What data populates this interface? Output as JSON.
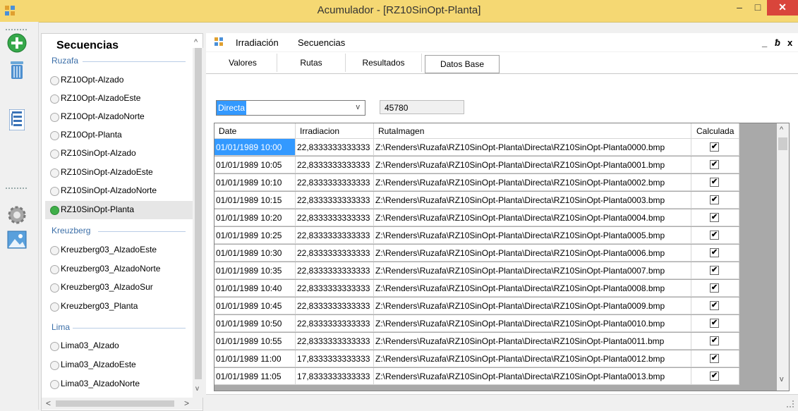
{
  "window": {
    "title": "Acumulador - [RZ10SinOpt-Planta]",
    "min_glyph": "–",
    "max_glyph": "□",
    "close_glyph": "✕"
  },
  "toolbar": {
    "icons": [
      "add-icon",
      "trash-icon",
      "tree-icon",
      "gear-icon",
      "image-icon"
    ]
  },
  "sequences": {
    "title": "Secuencias",
    "groups": [
      {
        "label": "Ruzafa"
      },
      {
        "label": "Kreuzberg"
      },
      {
        "label": "Lima"
      }
    ],
    "items": [
      "RZ10Opt-Alzado",
      "RZ10Opt-AlzadoEste",
      "RZ10Opt-AlzadoNorte",
      "RZ10Opt-Planta",
      "RZ10SinOpt-Alzado",
      "RZ10SinOpt-AlzadoEste",
      "RZ10SinOpt-AlzadoNorte",
      "RZ10SinOpt-Planta",
      "Kreuzberg03_AlzadoEste",
      "Kreuzberg03_AlzadoNorte",
      "Kreuzberg03_AlzadoSur",
      "Kreuzberg03_Planta",
      "Lima03_Alzado",
      "Lima03_AlzadoEste",
      "Lima03_AlzadoNorte"
    ],
    "selected": "RZ10SinOpt-Planta"
  },
  "menu": {
    "items": [
      "Irradiación",
      "Secuencias"
    ],
    "mdi_min": "_",
    "mdi_restore": "ƀ",
    "mdi_close": "x"
  },
  "tabs": [
    "Valores",
    "Rutas",
    "Resultados",
    "Datos Base"
  ],
  "active_tab": "Datos Base",
  "filter": {
    "dropdown_value": "Directa",
    "count_value": "45780"
  },
  "grid": {
    "columns": [
      "Date",
      "Irradiacion",
      "RutaImagen",
      "Calculada"
    ],
    "check_glyph": "✔",
    "rows": [
      {
        "date": "01/01/1989 10:00",
        "irr": "22,8333333333333",
        "ruta": "Z:\\Renders\\Ruzafa\\RZ10SinOpt-Planta\\Directa\\RZ10SinOpt-Planta0000.bmp"
      },
      {
        "date": "01/01/1989 10:05",
        "irr": "22,8333333333333",
        "ruta": "Z:\\Renders\\Ruzafa\\RZ10SinOpt-Planta\\Directa\\RZ10SinOpt-Planta0001.bmp"
      },
      {
        "date": "01/01/1989 10:10",
        "irr": "22,8333333333333",
        "ruta": "Z:\\Renders\\Ruzafa\\RZ10SinOpt-Planta\\Directa\\RZ10SinOpt-Planta0002.bmp"
      },
      {
        "date": "01/01/1989 10:15",
        "irr": "22,8333333333333",
        "ruta": "Z:\\Renders\\Ruzafa\\RZ10SinOpt-Planta\\Directa\\RZ10SinOpt-Planta0003.bmp"
      },
      {
        "date": "01/01/1989 10:20",
        "irr": "22,8333333333333",
        "ruta": "Z:\\Renders\\Ruzafa\\RZ10SinOpt-Planta\\Directa\\RZ10SinOpt-Planta0004.bmp"
      },
      {
        "date": "01/01/1989 10:25",
        "irr": "22,8333333333333",
        "ruta": "Z:\\Renders\\Ruzafa\\RZ10SinOpt-Planta\\Directa\\RZ10SinOpt-Planta0005.bmp"
      },
      {
        "date": "01/01/1989 10:30",
        "irr": "22,8333333333333",
        "ruta": "Z:\\Renders\\Ruzafa\\RZ10SinOpt-Planta\\Directa\\RZ10SinOpt-Planta0006.bmp"
      },
      {
        "date": "01/01/1989 10:35",
        "irr": "22,8333333333333",
        "ruta": "Z:\\Renders\\Ruzafa\\RZ10SinOpt-Planta\\Directa\\RZ10SinOpt-Planta0007.bmp"
      },
      {
        "date": "01/01/1989 10:40",
        "irr": "22,8333333333333",
        "ruta": "Z:\\Renders\\Ruzafa\\RZ10SinOpt-Planta\\Directa\\RZ10SinOpt-Planta0008.bmp"
      },
      {
        "date": "01/01/1989 10:45",
        "irr": "22,8333333333333",
        "ruta": "Z:\\Renders\\Ruzafa\\RZ10SinOpt-Planta\\Directa\\RZ10SinOpt-Planta0009.bmp"
      },
      {
        "date": "01/01/1989 10:50",
        "irr": "22,8333333333333",
        "ruta": "Z:\\Renders\\Ruzafa\\RZ10SinOpt-Planta\\Directa\\RZ10SinOpt-Planta0010.bmp"
      },
      {
        "date": "01/01/1989 10:55",
        "irr": "22,8333333333333",
        "ruta": "Z:\\Renders\\Ruzafa\\RZ10SinOpt-Planta\\Directa\\RZ10SinOpt-Planta0011.bmp"
      },
      {
        "date": "01/01/1989 11:00",
        "irr": "17,8333333333333",
        "ruta": "Z:\\Renders\\Ruzafa\\RZ10SinOpt-Planta\\Directa\\RZ10SinOpt-Planta0012.bmp"
      },
      {
        "date": "01/01/1989 11:05",
        "irr": "17,8333333333333",
        "ruta": "Z:\\Renders\\Ruzafa\\RZ10SinOpt-Planta\\Directa\\RZ10SinOpt-Planta0013.bmp"
      }
    ]
  },
  "colors": {
    "titlebar": "#f5d873",
    "close": "#d9453b",
    "selection": "#3399ff",
    "group_label": "#3c6fa8"
  }
}
